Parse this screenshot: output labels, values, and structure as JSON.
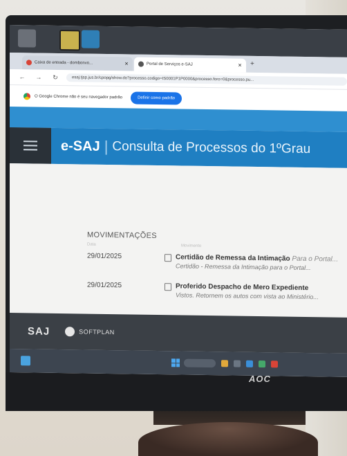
{
  "browser": {
    "tabs": [
      {
        "label": "Caixa de entrada - dombonvo...",
        "active": false
      },
      {
        "label": "Portal de Serviços e-SAJ",
        "active": true
      }
    ],
    "url": "esaj.tjsp.jus.br/cpopg/show.do?processo.codigo=IS0001P1P0000&processo.foro=0&processo.pu...",
    "infobar_text": "O Google Chrome não é seu navegador padrão",
    "infobar_button": "Definir como padrão"
  },
  "site": {
    "brand": "e-SAJ",
    "separator": "|",
    "subtitle": "Consulta de Processos do 1ºGrau",
    "section_title": "MOVIMENTAÇÕES",
    "col_date": "Data",
    "col_movement": "Movimento",
    "movements": [
      {
        "date": "29/01/2025",
        "title": "Certidão de Remessa da Intimação",
        "title_suffix": "Para o Portal...",
        "description": "Certidão - Remessa da Intimação para o Portal..."
      },
      {
        "date": "29/01/2025",
        "title": "Proferido Despacho de Mero Expediente",
        "title_suffix": "",
        "description": "Vistos. Retornem os autos com vista ao Ministério..."
      }
    ],
    "footer_logo": "SAJ",
    "footer_company": "SOFTPLAN"
  },
  "monitor": {
    "brand": "AOC"
  },
  "colors": {
    "header": "#1f7fc2",
    "footer": "#3b4046",
    "button": "#1a73e8"
  }
}
